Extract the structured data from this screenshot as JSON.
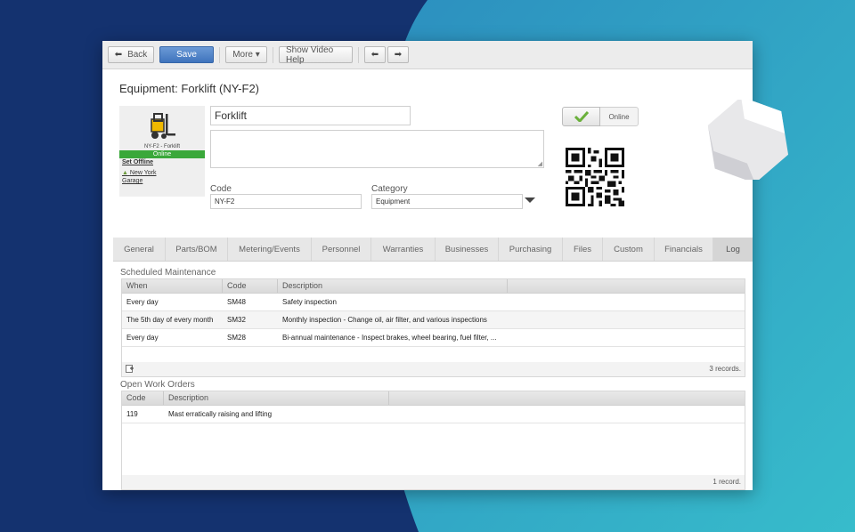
{
  "toolbar": {
    "back_label": "Back",
    "save_label": "Save",
    "more_label": "More ▾",
    "video_help_label": "Show Video Help"
  },
  "page_title": "Equipment: Forklift (NY-F2)",
  "asset_card": {
    "caption": "NY-F2 - Forklift",
    "status": "Online",
    "set_offline_link": "Set Offline",
    "location_link": "New York Garage"
  },
  "form": {
    "name_value": "Forklift",
    "description_value": "",
    "code_label": "Code",
    "code_value": "NY-F2",
    "category_label": "Category",
    "category_value": "Equipment"
  },
  "status_toggle": {
    "label": "Online"
  },
  "tabs": [
    {
      "label": "General"
    },
    {
      "label": "Parts/BOM"
    },
    {
      "label": "Metering/Events"
    },
    {
      "label": "Personnel"
    },
    {
      "label": "Warranties"
    },
    {
      "label": "Businesses"
    },
    {
      "label": "Purchasing"
    },
    {
      "label": "Files"
    },
    {
      "label": "Custom"
    },
    {
      "label": "Financials"
    },
    {
      "label": "Log"
    }
  ],
  "scheduled_maintenance": {
    "title": "Scheduled Maintenance",
    "columns": [
      "When",
      "Code",
      "Description"
    ],
    "rows": [
      {
        "when": "Every day",
        "code": "SM48",
        "description": "Safety inspection"
      },
      {
        "when": "The 5th day of every month",
        "code": "SM32",
        "description": "Monthly inspection - Change oil, air filter, and various inspections"
      },
      {
        "when": "Every day",
        "code": "SM28",
        "description": "Bi-annual maintenance - Inspect brakes, wheel bearing, fuel filter, ..."
      }
    ],
    "record_count": "3 records."
  },
  "open_work_orders": {
    "title": "Open Work Orders",
    "columns": [
      "Code",
      "Description"
    ],
    "rows": [
      {
        "code": "119",
        "description": "Mast erratically raising and lifting"
      }
    ],
    "record_count": "1 record."
  },
  "colors": {
    "background_dark": "#14326f",
    "background_teal": "#2aa4c4",
    "save_button": "#3f74bd",
    "online_green": "#3aa83a"
  }
}
